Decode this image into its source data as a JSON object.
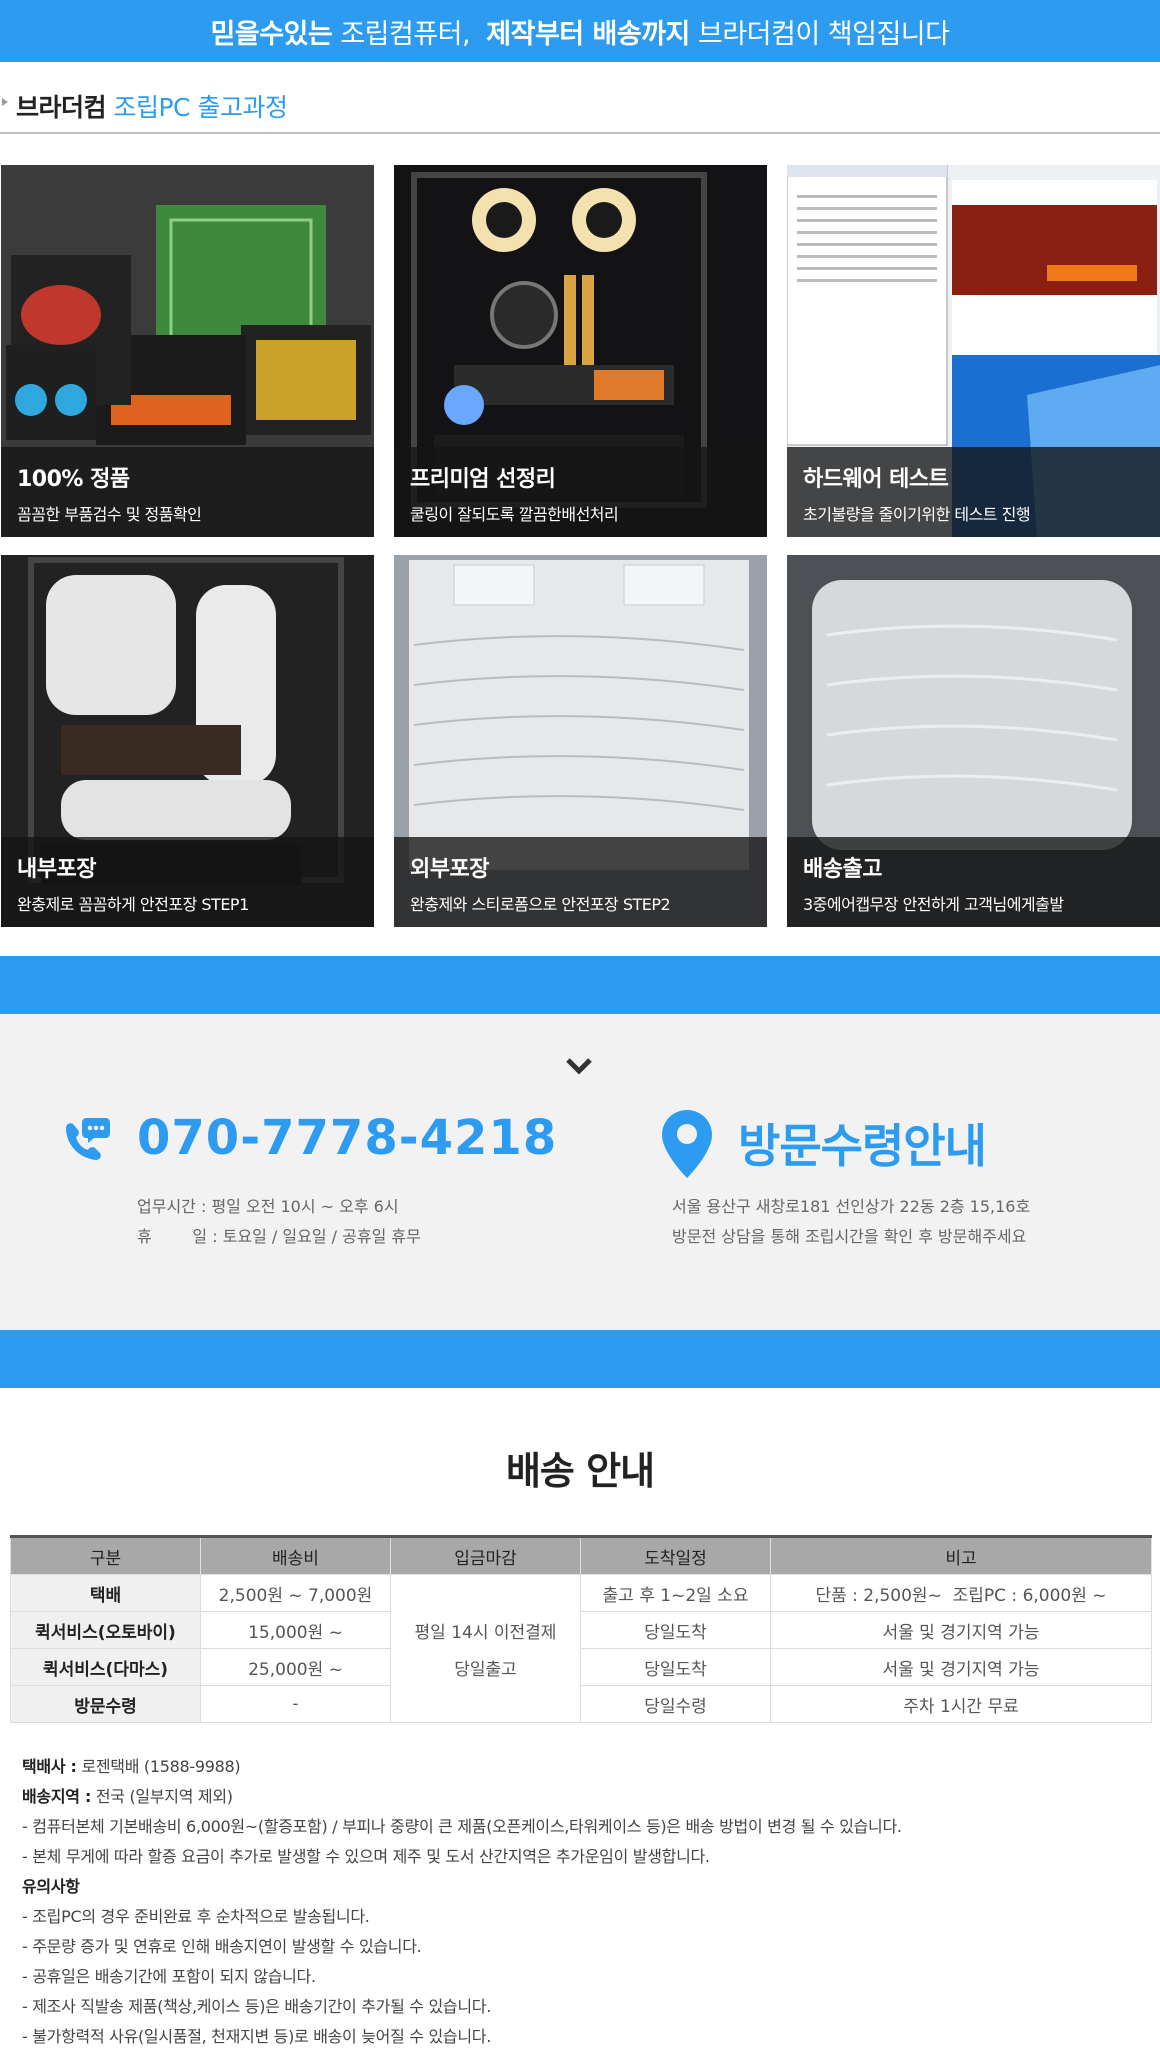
{
  "banner": {
    "part1_bold": "믿을수있는",
    "part2": "조립컴퓨터,",
    "part3_bold": "제작부터 배송까지",
    "part4": "브라더컴이 책임집니다"
  },
  "section": {
    "title_dark": "브라더컴",
    "title_blue": "조립PC 출고과정"
  },
  "steps": [
    {
      "title": "100% 정품",
      "desc": "꼼꼼한 부품검수 및 정품확인"
    },
    {
      "title": "프리미엄 선정리",
      "desc": "쿨링이 잘되도록 깔끔한배선처리"
    },
    {
      "title": "하드웨어 테스트",
      "desc": "초기불량을 줄이기위한 테스트 진행"
    },
    {
      "title": "내부포장",
      "desc": "완충제로 꼼꼼하게 안전포장 STEP1"
    },
    {
      "title": "외부포장",
      "desc": "완충제와 스티로폼으로 안전포장 STEP2"
    },
    {
      "title": "배송출고",
      "desc": "3중에어캡무장 안전하게 고객님에게출발"
    }
  ],
  "contact": {
    "phone": "070-7778-4218",
    "hours": "업무시간 : 평일 오전 10시 ~ 오후 6시",
    "holiday": "휴        일 : 토요일 / 일요일 / 공휴일 휴무",
    "visit_title": "방문수령안내",
    "address": "서울 용산구 새창로181 선인상가 22동 2층 15,16호",
    "visit_note": "방문전 상담을 통해 조립시간을 확인 후 방문해주세요"
  },
  "delivery": {
    "title": "배송 안내",
    "headers": [
      "구분",
      "배송비",
      "입금마감",
      "도착일정",
      "비고"
    ],
    "deadline_line1": "평일 14시 이전결제",
    "deadline_line2": "당일출고",
    "rows": [
      {
        "type": "택배",
        "fee": "2,500원 ~ 7,000원",
        "arrival": "출고 후 1~2일 소요",
        "note": "단품 : 2,500원~  조립PC : 6,000원 ~"
      },
      {
        "type": "퀵서비스(오토바이)",
        "fee": "15,000원 ~",
        "arrival": "당일도착",
        "note": "서울 및 경기지역 가능"
      },
      {
        "type": "퀵서비스(다마스)",
        "fee": "25,000원 ~",
        "arrival": "당일도착",
        "note": "서울 및 경기지역 가능"
      },
      {
        "type": "방문수령",
        "fee": "-",
        "arrival": "당일수령",
        "note": "주차 1시간 무료"
      }
    ]
  },
  "notes": {
    "courier_label": "택배사 :",
    "courier_value": "로젠택배 (1588-9988)",
    "area_label": "배송지역 :",
    "area_value": "전국 (일부지역 제외)",
    "line1": "- 컴퓨터본체 기본배송비 6,000원~(할증포함) / 부피나 중량이 큰 제품(오픈케이스,타워케이스 등)은 배송 방법이 변경 될 수 있습니다.",
    "line2": "- 본체 무게에 따라 할증 요금이 추가로 발생할 수 있으며 제주 및 도서 산간지역은 추가운임이 발생합니다.",
    "caution_label": "유의사항",
    "caution1": "- 조립PC의 경우 준비완료 후 순차적으로 발송됩니다.",
    "caution2": "- 주문량 증가 및 연휴로 인해 배송지연이 발생할 수 있습니다.",
    "caution3": "- 공휴일은 배송기간에 포함이 되지 않습니다.",
    "caution4": "- 제조사 직발송 제품(책상,케이스 등)은 배송기간이 추가될 수 있습니다.",
    "caution5": "- 불가항력적 사유(일시품절, 천재지변 등)로 배송이 늦어질 수 있습니다."
  },
  "colors": {
    "accent": "#2c9bf0",
    "table_header": "#a8a8a8"
  }
}
